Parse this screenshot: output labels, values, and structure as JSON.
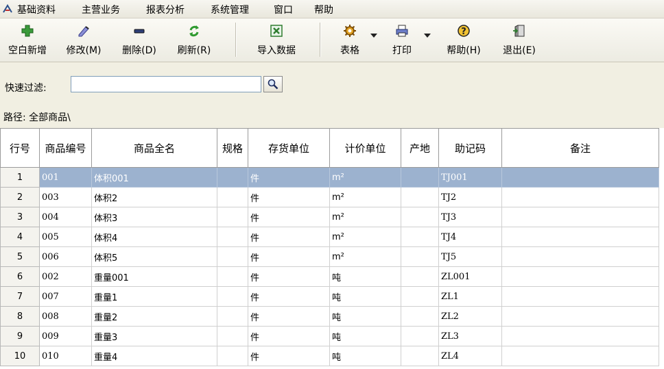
{
  "menu": {
    "items": [
      {
        "label": "基础资料"
      },
      {
        "label": "主营业务"
      },
      {
        "label": "报表分析"
      },
      {
        "label": "系统管理"
      },
      {
        "label": "窗口"
      },
      {
        "label": "帮助"
      }
    ]
  },
  "toolbar": {
    "new_label": "空白新增",
    "edit_label": "修改(M)",
    "delete_label": "删除(D)",
    "refresh_label": "刷新(R)",
    "import_label": "导入数据",
    "table_label": "表格",
    "print_label": "打印",
    "help_label": "帮助(H)",
    "exit_label": "退出(E)"
  },
  "filter": {
    "label": "快速过滤:",
    "value": ""
  },
  "path": {
    "label": "路径: 全部商品\\"
  },
  "grid": {
    "columns": [
      "行号",
      "商品编号",
      "商品全名",
      "规格",
      "存货单位",
      "计价单位",
      "产地",
      "助记码",
      "备注"
    ],
    "selected_row": 0,
    "rows": [
      [
        "1",
        "001",
        "体积001",
        "",
        "件",
        "m²",
        "",
        "TJ001",
        ""
      ],
      [
        "2",
        "003",
        "体积2",
        "",
        "件",
        "m²",
        "",
        "TJ2",
        ""
      ],
      [
        "3",
        "004",
        "体积3",
        "",
        "件",
        "m²",
        "",
        "TJ3",
        ""
      ],
      [
        "4",
        "005",
        "体积4",
        "",
        "件",
        "m²",
        "",
        "TJ4",
        ""
      ],
      [
        "5",
        "006",
        "体积5",
        "",
        "件",
        "m²",
        "",
        "TJ5",
        ""
      ],
      [
        "6",
        "002",
        "重量001",
        "",
        "件",
        "吨",
        "",
        "ZL001",
        ""
      ],
      [
        "7",
        "007",
        "重量1",
        "",
        "件",
        "吨",
        "",
        "ZL1",
        ""
      ],
      [
        "8",
        "008",
        "重量2",
        "",
        "件",
        "吨",
        "",
        "ZL2",
        ""
      ],
      [
        "9",
        "009",
        "重量3",
        "",
        "件",
        "吨",
        "",
        "ZL3",
        ""
      ],
      [
        "10",
        "010",
        "重量4",
        "",
        "件",
        "吨",
        "",
        "ZL4",
        ""
      ]
    ]
  },
  "colors": {
    "selection": "#9cb2cf",
    "panel": "#f1efe2"
  }
}
